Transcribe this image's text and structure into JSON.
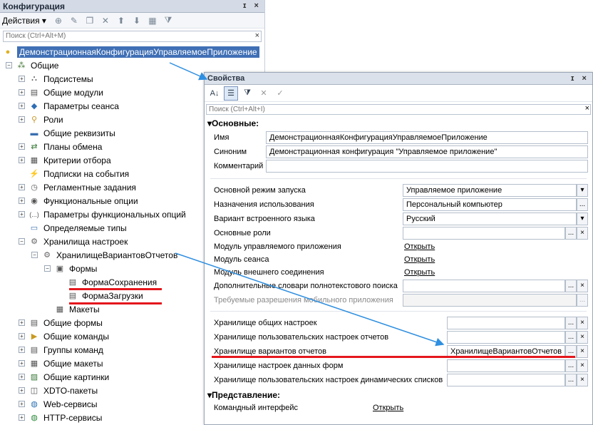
{
  "config_panel": {
    "title": "Конфигурация",
    "title_buttons": "ɪ ×",
    "toolbar": {
      "actions_label": "Действия ▾"
    },
    "search_placeholder": "Поиск (Ctrl+Alt+M)",
    "search_clear": "×",
    "tree": [
      {
        "label": "ДемонстрационнаяКонфигурацияУправляемоеПриложение",
        "icon": "config-root-icon",
        "glyph": "●",
        "color": "#e0b020"
      },
      {
        "label": "Общие",
        "icon": "common-icon",
        "glyph": "⁂",
        "color": "#4a7a3a",
        "exp": "−"
      },
      {
        "label": "Подсистемы",
        "icon": "subsystems-icon",
        "glyph": "⛬",
        "color": "#555",
        "exp": "+"
      },
      {
        "label": "Общие модули",
        "icon": "module-icon",
        "glyph": "▤",
        "color": "#555",
        "exp": "+"
      },
      {
        "label": "Параметры сеанса",
        "icon": "session-param-icon",
        "glyph": "◆",
        "color": "#2f6db5",
        "exp": "+"
      },
      {
        "label": "Роли",
        "icon": "role-icon",
        "glyph": "⚲",
        "color": "#c8962a",
        "exp": "+"
      },
      {
        "label": "Общие реквизиты",
        "icon": "attribute-icon",
        "glyph": "▬",
        "color": "#3a6fb0",
        "exp": ""
      },
      {
        "label": "Планы обмена",
        "icon": "exchange-plan-icon",
        "glyph": "⇄",
        "color": "#3a7a3a",
        "exp": "+"
      },
      {
        "label": "Критерии отбора",
        "icon": "filter-criteria-icon",
        "glyph": "▦",
        "color": "#555",
        "exp": "+"
      },
      {
        "label": "Подписки на события",
        "icon": "event-subscription-icon",
        "glyph": "⚡",
        "color": "#d08a00",
        "exp": ""
      },
      {
        "label": "Регламентные задания",
        "icon": "scheduled-job-icon",
        "glyph": "◷",
        "color": "#555",
        "exp": "+"
      },
      {
        "label": "Функциональные опции",
        "icon": "functional-option-icon",
        "glyph": "◉",
        "color": "#555",
        "exp": "+"
      },
      {
        "label": "Параметры функциональных опций",
        "icon": "functional-param-icon",
        "glyph": "(...)",
        "color": "#555",
        "exp": "+"
      },
      {
        "label": "Определяемые типы",
        "icon": "defined-type-icon",
        "glyph": "▭",
        "color": "#3a6fb0",
        "exp": ""
      },
      {
        "label": "Хранилища настроек",
        "icon": "settings-storage-icon",
        "glyph": "⚙",
        "color": "#666",
        "exp": "−"
      },
      {
        "label": "ХранилищеВариантовОтчетов",
        "icon": "settings-storage-icon",
        "glyph": "⚙",
        "color": "#666",
        "exp": "−"
      },
      {
        "label": "Формы",
        "icon": "forms-folder-icon",
        "glyph": "▣",
        "color": "#555",
        "exp": "−"
      },
      {
        "label": "ФормаСохранения",
        "icon": "form-icon",
        "glyph": "▤",
        "color": "#555",
        "exp": ""
      },
      {
        "label": "ФормаЗагрузки",
        "icon": "form-icon",
        "glyph": "▤",
        "color": "#555",
        "exp": ""
      },
      {
        "label": "Макеты",
        "icon": "template-icon",
        "glyph": "▦",
        "color": "#555",
        "exp": ""
      },
      {
        "label": "Общие формы",
        "icon": "common-form-icon",
        "glyph": "▤",
        "color": "#555",
        "exp": "+"
      },
      {
        "label": "Общие команды",
        "icon": "command-icon",
        "glyph": "▶",
        "color": "#c89a20",
        "exp": "+"
      },
      {
        "label": "Группы команд",
        "icon": "command-group-icon",
        "glyph": "▤",
        "color": "#555",
        "exp": "+"
      },
      {
        "label": "Общие макеты",
        "icon": "common-template-icon",
        "glyph": "▦",
        "color": "#555",
        "exp": "+"
      },
      {
        "label": "Общие картинки",
        "icon": "picture-icon",
        "glyph": "▨",
        "color": "#3a7a3a",
        "exp": "+"
      },
      {
        "label": "XDTO-пакеты",
        "icon": "xdto-icon",
        "glyph": "◫",
        "color": "#555",
        "exp": "+"
      },
      {
        "label": "Web-сервисы",
        "icon": "web-service-icon",
        "glyph": "◍",
        "color": "#2a6fb0",
        "exp": "+"
      },
      {
        "label": "HTTP-сервисы",
        "icon": "http-service-icon",
        "glyph": "◍",
        "color": "#2a8a3a",
        "exp": "+"
      }
    ]
  },
  "properties_panel": {
    "title": "Свойства",
    "title_buttons": "ɪ ×",
    "search_placeholder": "Поиск (Ctrl+Alt+I)",
    "search_clear": "×",
    "groups": {
      "main": "Основные:",
      "view": "Представление:"
    },
    "fields": {
      "name": {
        "label": "Имя",
        "value": "ДемонстрационнаяКонфигурацияУправляемоеПриложение"
      },
      "synonym": {
        "label": "Синоним",
        "value": "Демонстрационная конфигурация \"Управляемое приложение\""
      },
      "comment": {
        "label": "Комментарий",
        "value": ""
      },
      "launch_mode": {
        "label": "Основной режим запуска",
        "value": "Управляемое приложение"
      },
      "purpose": {
        "label": "Назначения использования",
        "value": "Персональный компьютер"
      },
      "script_variant": {
        "label": "Вариант встроенного языка",
        "value": "Русский"
      },
      "main_roles": {
        "label": "Основные роли",
        "value": ""
      },
      "managed_app_module": {
        "label": "Модуль управляемого приложения",
        "link": "Открыть"
      },
      "session_module": {
        "label": "Модуль сеанса",
        "link": "Открыть"
      },
      "ext_conn_module": {
        "label": "Модуль внешнего соединения",
        "link": "Открыть"
      },
      "fts_dicts": {
        "label": "Дополнительные словари полнотекстового поиска",
        "value": ""
      },
      "mobile_perm": {
        "label": "Требуемые разрешения мобильного приложения",
        "value": ""
      },
      "common_settings": {
        "label": "Хранилище общих настроек",
        "value": ""
      },
      "user_report_settings": {
        "label": "Хранилище пользовательских настроек отчетов",
        "value": ""
      },
      "report_variants": {
        "label": "Хранилище вариантов отчетов",
        "value": "ХранилищеВариантовОтчетов"
      },
      "form_data_settings": {
        "label": "Хранилище настроек данных форм",
        "value": ""
      },
      "user_dyn_list": {
        "label": "Хранилище пользовательских настроек динамических списков",
        "value": ""
      },
      "command_interface": {
        "label": "Командный интерфейс",
        "link": "Открыть"
      }
    },
    "btn_select": "...",
    "btn_clear": "×",
    "btn_dropdown": "▾"
  },
  "colors": {
    "selection": "#3f6fb5",
    "annotation_red": "#e5161d",
    "arrow_blue": "#2f8fe0"
  }
}
